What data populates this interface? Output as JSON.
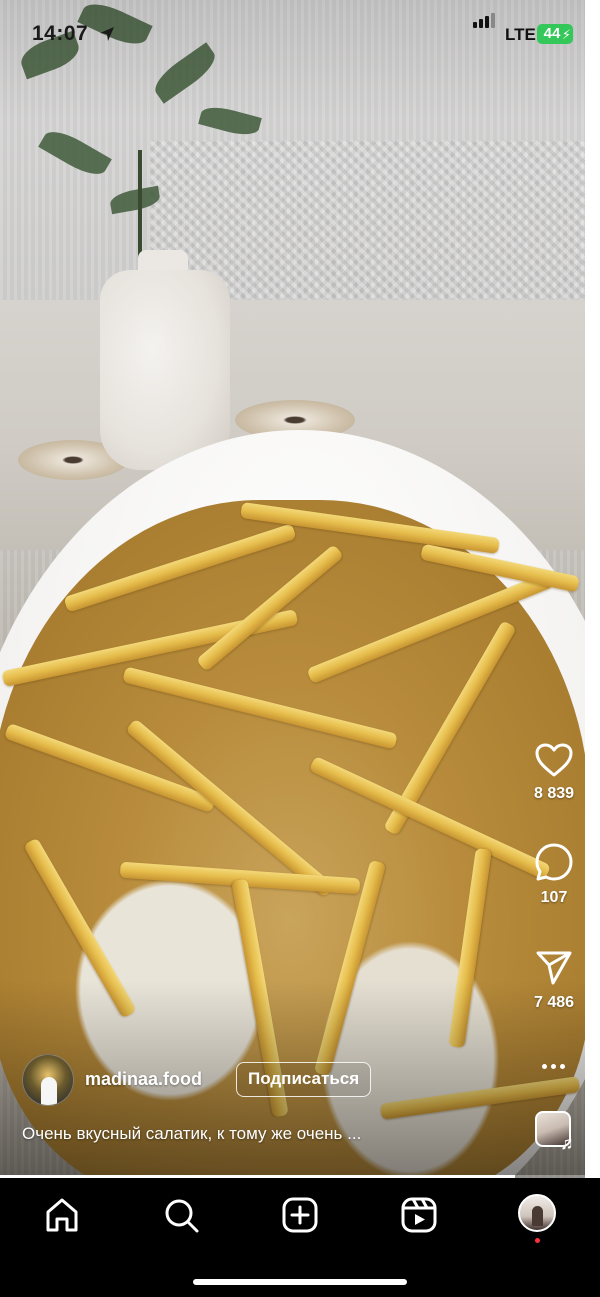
{
  "status_bar": {
    "time": "14:07",
    "network": "LTE",
    "battery": "44"
  },
  "reel": {
    "author": {
      "username": "madinaa.food",
      "follow_label": "Подписаться"
    },
    "caption": "Очень вкусный салатик, к тому же очень ...",
    "actions": {
      "likes": "8 839",
      "comments": "107",
      "shares": "7 486"
    },
    "icons": {
      "like": "heart-icon",
      "comment": "comment-icon",
      "share": "paper-plane-icon",
      "more": "more-dots-icon",
      "audio": "music-note-icon"
    }
  },
  "bottom_nav": {
    "items": [
      "home-icon",
      "search-icon",
      "create-icon",
      "reels-icon",
      "profile-avatar"
    ],
    "accent_dot_color": "#ff3040"
  },
  "colors": {
    "battery": "#34c759",
    "nav_background": "#000000",
    "text_on_media": "#ffffff"
  }
}
